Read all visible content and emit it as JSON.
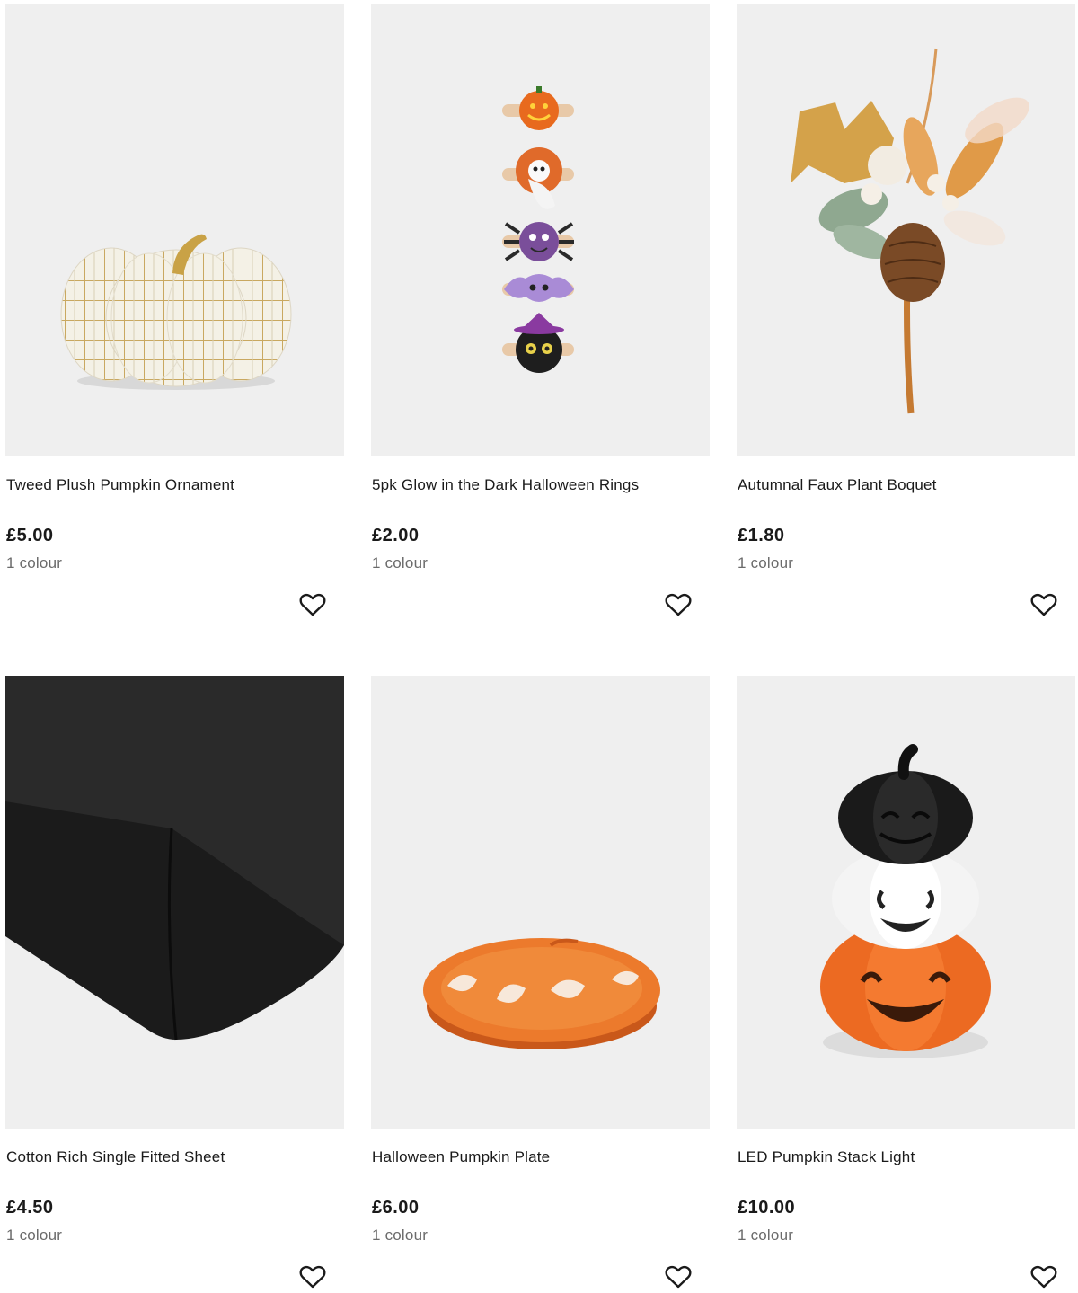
{
  "products": [
    {
      "title": "Tweed Plush Pumpkin Ornament",
      "price": "£5.00",
      "colours": "1 colour",
      "wishlist_icon": "heart-outline-icon"
    },
    {
      "title": "5pk Glow in the Dark Halloween Rings",
      "price": "£2.00",
      "colours": "1 colour",
      "wishlist_icon": "heart-outline-icon"
    },
    {
      "title": "Autumnal Faux Plant Boquet",
      "price": "£1.80",
      "colours": "1 colour",
      "wishlist_icon": "heart-outline-icon"
    },
    {
      "title": "Cotton Rich Single Fitted Sheet",
      "price": "£4.50",
      "colours": "1 colour",
      "wishlist_icon": "heart-outline-icon"
    },
    {
      "title": "Halloween Pumpkin Plate",
      "price": "£6.00",
      "colours": "1 colour",
      "wishlist_icon": "heart-outline-icon"
    },
    {
      "title": "LED Pumpkin Stack Light",
      "price": "£10.00",
      "colours": "1 colour",
      "wishlist_icon": "heart-outline-icon"
    }
  ],
  "colors": {
    "image_background": "#efefef",
    "text_primary": "#1a1a1a",
    "text_secondary": "#6b6b6b"
  }
}
